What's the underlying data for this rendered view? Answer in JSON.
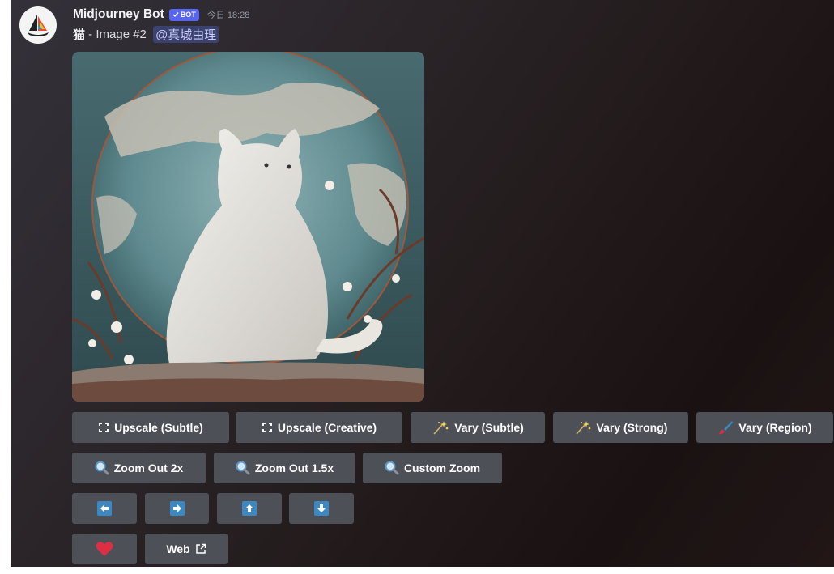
{
  "message": {
    "author": "Midjourney Bot",
    "bot_tag": "BOT",
    "timestamp": "今日 18:28",
    "prompt": "猫",
    "image_label": " - Image #2 ",
    "mention": "@真城由理"
  },
  "icons": {
    "avatar": "midjourney-sailboat-logo",
    "verified": "check-icon",
    "upscale": "expand-arrows-icon",
    "vary": "sparkles-icon",
    "vary_region": "paintbrush-icon",
    "zoom": "magnifier-icon",
    "pan_left": "left-arrow-icon",
    "pan_right": "right-arrow-icon",
    "pan_up": "up-arrow-icon",
    "pan_down": "down-arrow-icon",
    "favorite": "heart-icon",
    "external": "external-link-icon"
  },
  "buttons": {
    "upscale_subtle": "Upscale (Subtle)",
    "upscale_creative": "Upscale (Creative)",
    "vary_subtle": "Vary (Subtle)",
    "vary_strong": "Vary (Strong)",
    "vary_region": "Vary (Region)",
    "zoom_out_2x": "Zoom Out 2x",
    "zoom_out_1_5x": "Zoom Out 1.5x",
    "custom_zoom": "Custom Zoom",
    "web": "Web"
  },
  "colors": {
    "button_bg": "#4e5058",
    "bot_tag": "#5865f2",
    "mention_bg": "#3c4270",
    "heart": "#dd2e44",
    "arrow_blue": "#3b88c3"
  }
}
